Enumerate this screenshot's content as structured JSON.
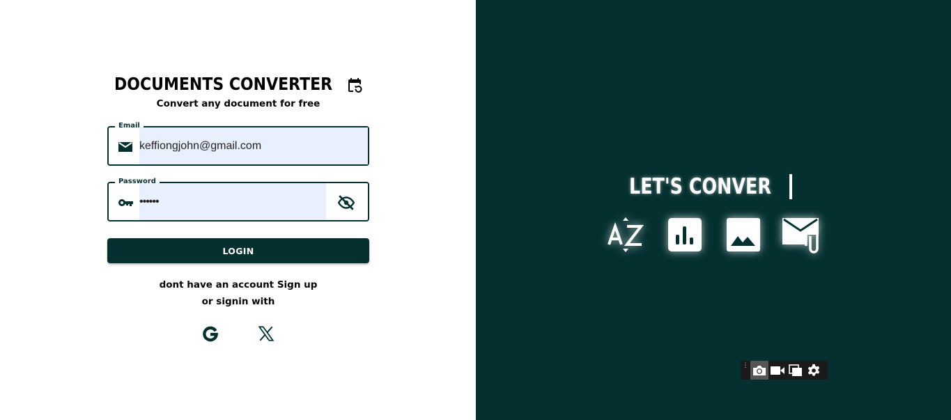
{
  "app": {
    "title": "DOCUMENTS CONVERTER",
    "subtitle": "Convert any document for free"
  },
  "form": {
    "email": {
      "label": "Email",
      "value": "keffiongjohn@gmail.com",
      "icon": "mail-icon"
    },
    "password": {
      "label": "Password",
      "value": "••••••",
      "icon": "key-icon",
      "toggle_icon": "visibility-off-icon"
    },
    "login_label": "LOGIN",
    "signup_text": "dont have an account Sign up",
    "signin_text": "or signin with"
  },
  "social": [
    "google-icon",
    "x-icon"
  ],
  "hero": {
    "typing_text": "LET'S CONVER",
    "icons": [
      "sort-az-icon",
      "bar-chart-icon",
      "image-icon",
      "mail-attachment-icon"
    ]
  },
  "capture_toolbar": {
    "items": [
      "camera-icon",
      "video-icon",
      "window-icon",
      "gear-icon"
    ]
  },
  "colors": {
    "brand": "#053030",
    "input_fill": "#e8f0fe",
    "background_light": "#ffffff"
  }
}
